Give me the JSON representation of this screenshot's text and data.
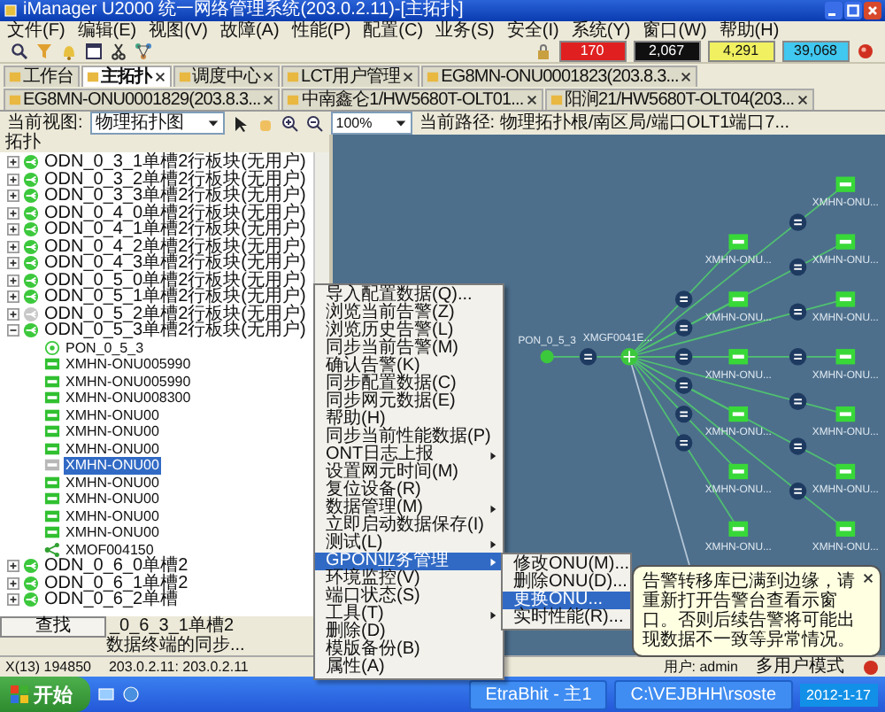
{
  "window": {
    "title": "iManager U2000 统一网络管理系统(203.0.2.11)-[主拓扑]"
  },
  "menu": [
    "文件(F)",
    "编辑(E)",
    "视图(V)",
    "故障(A)",
    "性能(P)",
    "配置(C)",
    "业务(S)",
    "安全(I)",
    "系统(Y)",
    "窗口(W)",
    "帮助(H)"
  ],
  "alarm_counts": [
    {
      "value": "170",
      "color": "#e02020"
    },
    {
      "value": "2,067",
      "color": "#101010"
    },
    {
      "value": "4,291",
      "color": "#f0f060"
    },
    {
      "value": "39,068",
      "color": "#40c8f0"
    }
  ],
  "tabs": [
    {
      "label": "工作台",
      "selected": false,
      "closable": false
    },
    {
      "label": "主拓扑",
      "selected": true,
      "closable": true
    },
    {
      "label": "调度中心",
      "selected": false,
      "closable": true
    },
    {
      "label": "LCT用户管理",
      "selected": false,
      "closable": true
    },
    {
      "label": "EG8MN-ONU0001823(203.8.3...",
      "selected": false,
      "closable": true
    },
    {
      "label": "EG8MN-ONU0001829(203.8.3...",
      "selected": false,
      "closable": true
    },
    {
      "label": "中南鑫仑1/HW5680T-OLT01...",
      "selected": false,
      "closable": true
    },
    {
      "label": "阳涧21/HW5680T-OLT04(203...",
      "selected": false,
      "closable": true
    }
  ],
  "view_bar": {
    "view_label": "当前视图:",
    "view_value": "物理拓扑图",
    "zoom": "100%",
    "path": "当前路径: 物理拓扑根/南区局/端口OLT1端口7..."
  },
  "tree": {
    "title": "拓扑",
    "items": [
      {
        "label": "ODN_0_3_1单槽2行板块(无用户)",
        "kind": "odn",
        "online": true,
        "expanded": false,
        "selected": false
      },
      {
        "label": "ODN_0_3_2单槽2行板块(无用户)",
        "kind": "odn",
        "online": true,
        "expanded": false,
        "selected": false
      },
      {
        "label": "ODN_0_3_3单槽2行板块(无用户)",
        "kind": "odn",
        "online": true,
        "expanded": false,
        "selected": false
      },
      {
        "label": "ODN_0_4_0单槽2行板块(无用户)",
        "kind": "odn",
        "online": true,
        "expanded": false,
        "selected": false
      },
      {
        "label": "ODN_0_4_1单槽2行板块(无用户)",
        "kind": "odn",
        "online": true,
        "expanded": false,
        "selected": false
      },
      {
        "label": "ODN_0_4_2单槽2行板块(无用户)",
        "kind": "odn",
        "online": true,
        "expanded": false,
        "selected": false
      },
      {
        "label": "ODN_0_4_3单槽2行板块(无用户)",
        "kind": "odn",
        "online": true,
        "expanded": false,
        "selected": false
      },
      {
        "label": "ODN_0_5_0单槽2行板块(无用户)",
        "kind": "odn",
        "online": true,
        "expanded": false,
        "selected": false
      },
      {
        "label": "ODN_0_5_1单槽2行板块(无用户)",
        "kind": "odn",
        "online": true,
        "expanded": false,
        "selected": false
      },
      {
        "label": "ODN_0_5_2单槽2行板块(无用户)",
        "kind": "odn",
        "online": false,
        "expanded": false,
        "selected": false
      },
      {
        "label": "ODN_0_5_3单槽2行板块(无用户)",
        "kind": "odn",
        "online": true,
        "expanded": true,
        "selected": false,
        "children": [
          {
            "label": "PON_0_5_3",
            "kind": "pon",
            "online": true,
            "selected": false
          },
          {
            "label": "XMHN-ONU005990",
            "kind": "onu",
            "online": true,
            "selected": false
          },
          {
            "label": "XMHN-ONU005990",
            "kind": "onu",
            "online": true,
            "selected": false
          },
          {
            "label": "XMHN-ONU008300",
            "kind": "onu",
            "online": true,
            "selected": false
          },
          {
            "label": "XMHN-ONU00",
            "kind": "onu",
            "online": true,
            "selected": false
          },
          {
            "label": "XMHN-ONU00",
            "kind": "onu",
            "online": true,
            "selected": false
          },
          {
            "label": "XMHN-ONU00",
            "kind": "onu",
            "online": true,
            "selected": false
          },
          {
            "label": "XMHN-ONU00",
            "kind": "onu",
            "online": false,
            "selected": true
          },
          {
            "label": "XMHN-ONU00",
            "kind": "onu",
            "online": true,
            "selected": false
          },
          {
            "label": "XMHN-ONU00",
            "kind": "onu",
            "online": true,
            "selected": false
          },
          {
            "label": "XMHN-ONU00",
            "kind": "onu",
            "online": true,
            "selected": false
          },
          {
            "label": "XMHN-ONU00",
            "kind": "onu",
            "online": true,
            "selected": false
          },
          {
            "label": "XMOF004150",
            "kind": "olt",
            "online": true,
            "selected": false
          }
        ]
      },
      {
        "label": "ODN_0_6_0单槽2",
        "kind": "odn",
        "online": true,
        "expanded": false,
        "selected": false
      },
      {
        "label": "ODN_0_6_1单槽2",
        "kind": "odn",
        "online": true,
        "expanded": false,
        "selected": false
      },
      {
        "label": "ODN_0_6_2单槽",
        "kind": "odn",
        "online": true,
        "expanded": false,
        "selected": false
      }
    ]
  },
  "find_button": "查找",
  "tree_partial": "_0_6_3_1单槽2",
  "tree_status": "数据终端的同步...",
  "topology": {
    "pon": "PON_0_5_3",
    "olt": "XMGF0041E...",
    "onus_near": [
      "XMHN-ONU...",
      "XMHN-ONU...",
      "XMHN-ONU...",
      "XMHN-ONU...",
      "XMHN-ONU...",
      "XMHN-ONU..."
    ],
    "onus_far": [
      "XMHN-ONU...",
      "XMHN-ONU...",
      "XMHN-ONU...",
      "XMHN-ONU...",
      "XMHN-ONU...",
      "XMHN-ONU...",
      "XMHN-ONU..."
    ]
  },
  "context_menu": {
    "items": [
      {
        "label": "导入配置数据(Q)...",
        "submenu": false,
        "selected": false
      },
      {
        "label": "浏览当前告警(Z)",
        "submenu": false,
        "selected": false
      },
      {
        "label": "浏览历史告警(L)",
        "submenu": false,
        "selected": false
      },
      {
        "label": "同步当前告警(M)",
        "submenu": false,
        "selected": false
      },
      {
        "label": "确认告警(K)",
        "submenu": false,
        "selected": false
      },
      {
        "label": "同步配置数据(C)",
        "submenu": false,
        "selected": false
      },
      {
        "label": "同步网元数据(E)",
        "submenu": false,
        "selected": false
      },
      {
        "label": "帮助(H)",
        "submenu": false,
        "selected": false
      },
      {
        "label": "同步当前性能数据(P)",
        "submenu": false,
        "selected": false
      },
      {
        "label": "ONT日志上报",
        "submenu": true,
        "selected": false
      },
      {
        "label": "设置网元时间(M)",
        "submenu": false,
        "selected": false
      },
      {
        "label": "复位设备(R)",
        "submenu": false,
        "selected": false
      },
      {
        "label": "数据管理(M)",
        "submenu": true,
        "selected": false
      },
      {
        "label": "立即启动数据保存(I)",
        "submenu": false,
        "selected": false
      },
      {
        "label": "测试(L)",
        "submenu": true,
        "selected": false
      },
      {
        "label": "GPON业务管理",
        "submenu": true,
        "selected": true
      },
      {
        "label": "环境监控(V)",
        "submenu": false,
        "selected": false
      },
      {
        "label": "端口状态(S)",
        "submenu": false,
        "selected": false
      },
      {
        "label": "工具(T)",
        "submenu": true,
        "selected": false
      },
      {
        "label": "删除(D)",
        "submenu": false,
        "selected": false
      },
      {
        "label": "模版备份(B)",
        "submenu": false,
        "selected": false
      },
      {
        "label": "属性(A)",
        "submenu": false,
        "selected": false
      }
    ]
  },
  "submenu": {
    "items": [
      {
        "label": "修改ONU(M)...",
        "selected": false
      },
      {
        "label": "删除ONU(D)...",
        "selected": false
      },
      {
        "label": "更换ONU...",
        "selected": true
      },
      {
        "label": "实时性能(R)...",
        "selected": false
      }
    ]
  },
  "notification": {
    "text": "告警转移库已满到边缘，请重新打开告警台查看示窗口。否则后续告警将可能出现数据不一致等异常情况。"
  },
  "status_bar": {
    "left": "X(13)  194850",
    "server": "203.0.2.11: 203.0.2.11",
    "user": "用户: admin",
    "mode": "多用户模式"
  },
  "taskbar": {
    "start": "开始",
    "tasks": [
      "EtraBhit - 主1",
      "C:\\VEJBHH\\rsoste"
    ],
    "clock": "2012-1-17"
  }
}
